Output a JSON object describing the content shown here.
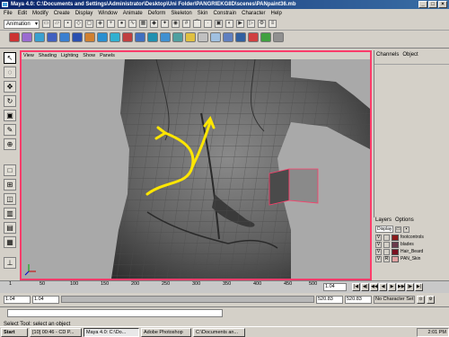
{
  "window": {
    "title": "Maya 4.0: C:\\Documents and Settings\\Administrator\\Desktop\\Uni Folder\\PANGRIEKG8D\\scenes\\PANpaint36.mb"
  },
  "menus": [
    "File",
    "Edit",
    "Modify",
    "Create",
    "Display",
    "Window",
    "Animate",
    "Deform",
    "Skeleton",
    "Skin",
    "Constrain",
    "Character",
    "Help"
  ],
  "mode_select": "Animation",
  "panel_menu": [
    "View",
    "Shading",
    "Lighting",
    "Show",
    "Panels"
  ],
  "channel_box": {
    "tabs": [
      "Channels",
      "Object"
    ]
  },
  "layers": {
    "menu": [
      "Layers",
      "Options"
    ],
    "selector": "Display",
    "items": [
      {
        "v": "V",
        "type": "",
        "color": "#8b1a1a",
        "name": "footcontrols"
      },
      {
        "v": "V",
        "type": "",
        "color": "#6a3a4a",
        "name": "blades"
      },
      {
        "v": "V",
        "type": "",
        "color": "#7a1020",
        "name": "Hair_Beard"
      },
      {
        "v": "V",
        "type": "R",
        "color": "#e0a0a0",
        "name": "PAN_Skin"
      }
    ]
  },
  "timeline": {
    "ticks": [
      "1",
      "50",
      "100",
      "150",
      "200",
      "250",
      "300",
      "350",
      "400",
      "450",
      "500"
    ],
    "current_frame": "1.04"
  },
  "range": {
    "start": "1.04",
    "playback_start": "1.04",
    "playback_end": "520.83",
    "end": "520.83",
    "character_set": "No Character Set"
  },
  "help_line": "Select Tool: select an object",
  "taskbar": {
    "start": "Start",
    "buttons": [
      "[10] 00:46 - CD P...",
      "Maya 4.0: C:\\Do...",
      "Adobe Photoshop",
      "C:\\Documents an..."
    ],
    "active_index": 1,
    "clock": "2:01 PM"
  }
}
